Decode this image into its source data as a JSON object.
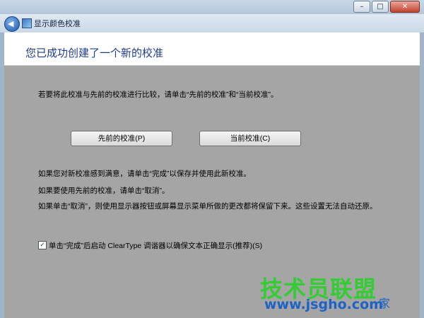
{
  "window": {
    "title": "显示颜色校准",
    "controls": {
      "minimize": "–",
      "maximize": "□",
      "close": "✕"
    }
  },
  "page": {
    "heading": "您已成功创建了一个新的校准",
    "compare_text": "若要将此校准与先前的校准进行比较，请单击“先前的校准”和“当前校准”。",
    "buttons": {
      "previous": "先前的校准(P)",
      "current": "当前校准(C)"
    },
    "info_lines": [
      "如果您对新校准感到满意，请单击“完成”以保存并使用此新校准。",
      "如果要使用先前的校准，请单击“取消”。",
      "如果单击“取消”，则使用显示器按钮或屏幕显示菜单所做的更改都将保留下来。这些设置无法自动还原。"
    ],
    "checkbox": {
      "checked": true,
      "mark": "✓",
      "label": "单击“完成”后启动 ClearType 调谐器以确保文本正确显示(推荐)(S)"
    }
  },
  "watermark": {
    "brand": "技术员联盟",
    "url": "www.jsgho.com",
    "tail": "家"
  },
  "colors": {
    "content_bg": "#a5a5a5",
    "heading": "#1d3c8f",
    "watermark_green": "#33cc33",
    "watermark_blue": "#1e63c4"
  }
}
